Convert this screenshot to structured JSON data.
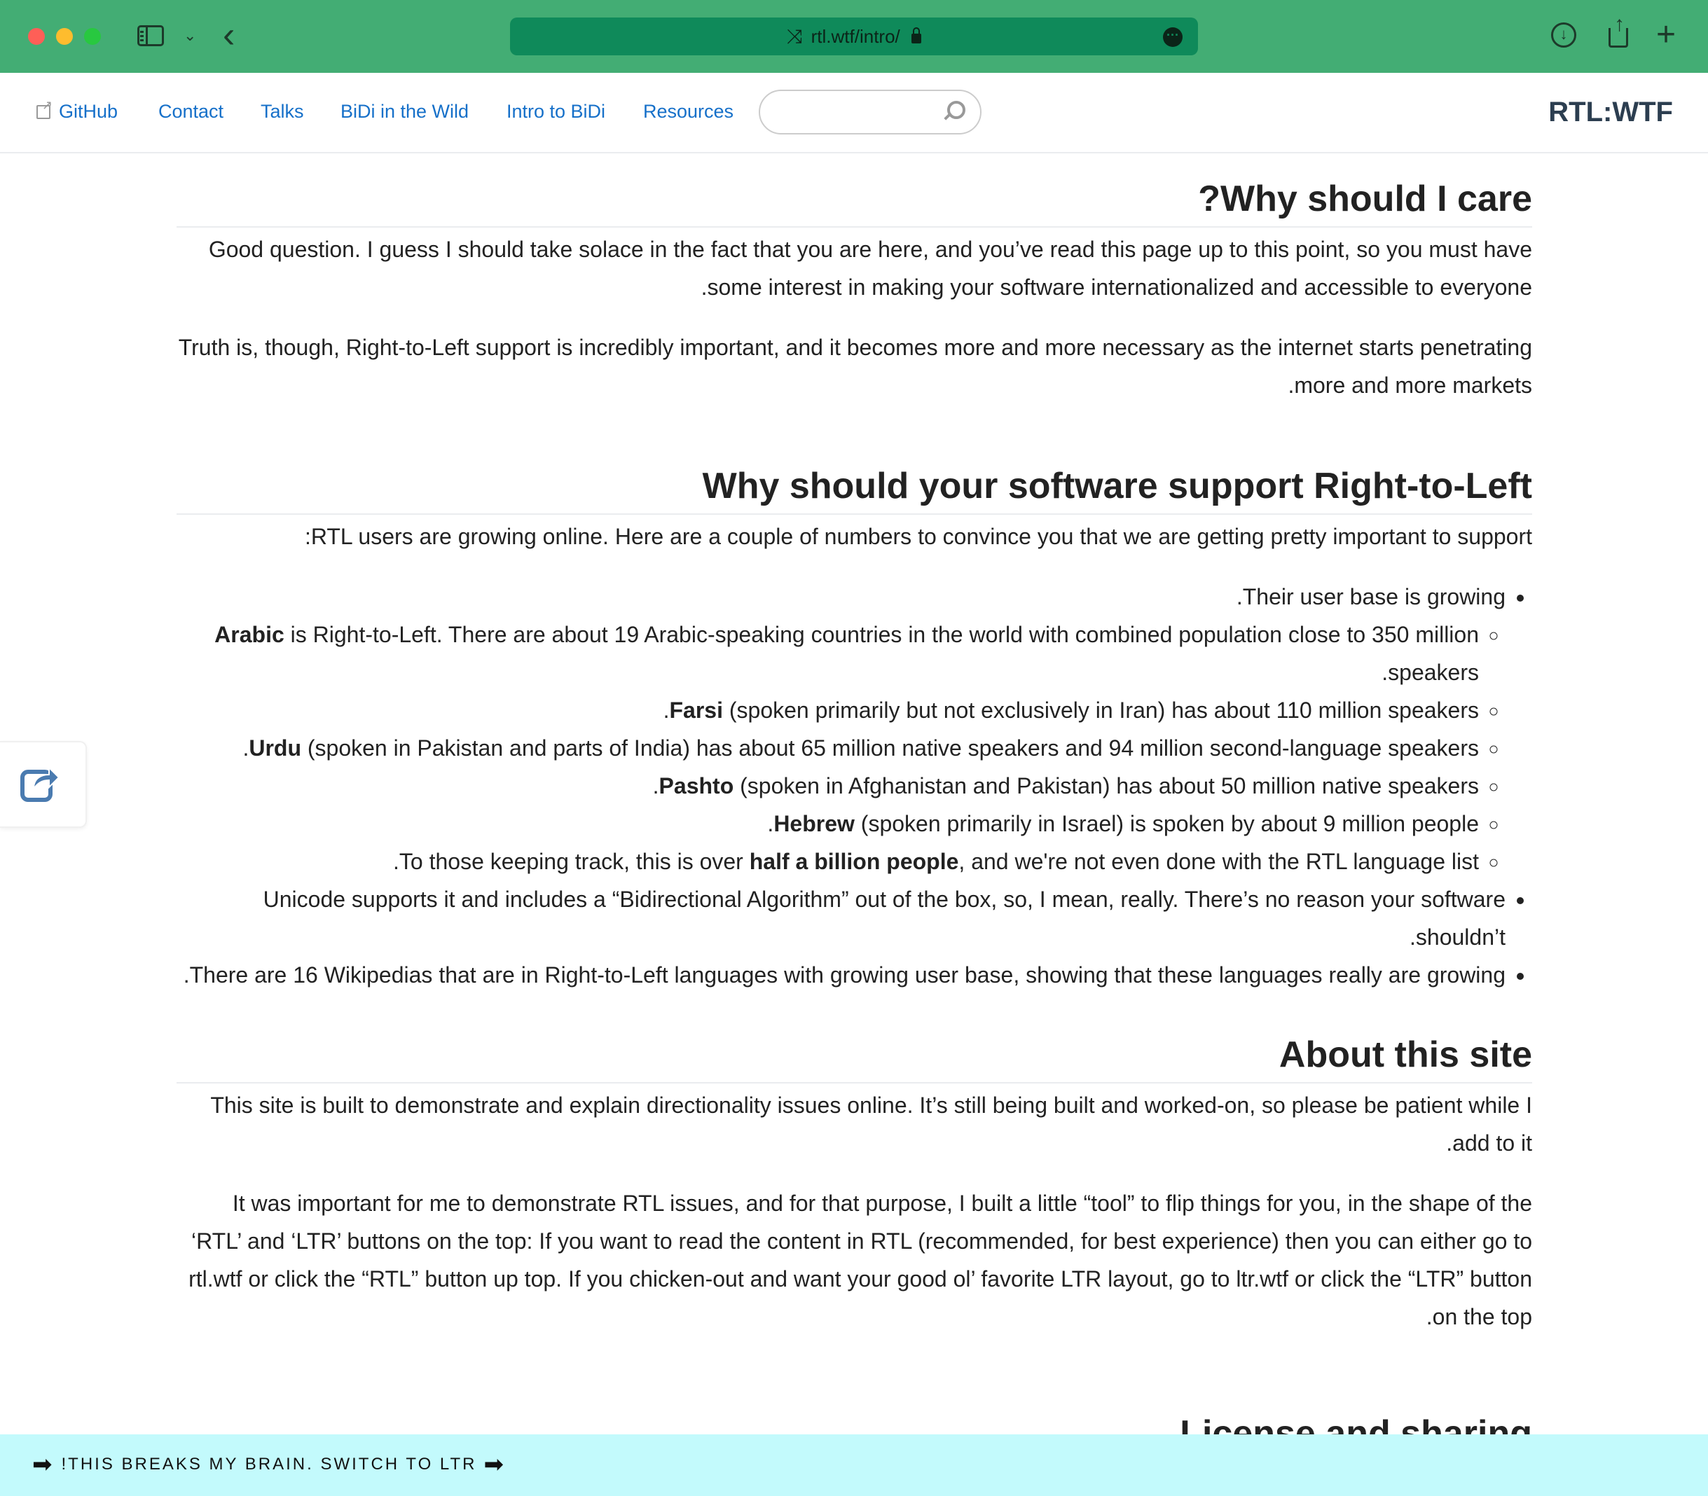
{
  "browser": {
    "url": "rtl.wtf/intro/"
  },
  "nav": {
    "links": [
      "GitHub",
      "Contact",
      "Talks",
      "BiDi in the Wild",
      "Intro to BiDi",
      "Resources"
    ],
    "search_placeholder": "",
    "site_title": "RTL:WTF"
  },
  "sections": {
    "care": {
      "heading": "Why should I care?",
      "p1": "Good question. I guess I should take solace in the fact that you are here, and you’ve read this page up to this point, so you must have some interest in making your software internationalized and accessible to everyone.",
      "p2": "Truth is, though, Right-to-Left support is incredibly important, and it becomes more and more necessary as the internet starts penetrating more and more markets."
    },
    "why": {
      "heading": "Why should your software support Right-to-Left",
      "intro": "RTL users are growing online. Here are a couple of numbers to convince you that we are getting pretty important to support:",
      "bullet1": "Their user base is growing.",
      "sub": [
        {
          "bold": "Arabic",
          "rest": " is Right-to-Left. There are about 19 Arabic-speaking countries in the world with combined population close to 350 million speakers."
        },
        {
          "bold": "Farsi",
          "rest": " (spoken primarily but not exclusively in Iran) has about 110 million speakers."
        },
        {
          "bold": "Urdu",
          "rest": " (spoken in Pakistan and parts of India) has about 65 million native speakers and 94 million second-language speakers."
        },
        {
          "bold": "Pashto",
          "rest": " (spoken in Afghanistan and Pakistan) has about 50 million native speakers."
        },
        {
          "bold": "Hebrew",
          "rest": " (spoken primarily in Israel) is spoken by about 9 million people."
        }
      ],
      "sub_last_pre": "To those keeping track, this is over ",
      "sub_last_bold": "half a billion people",
      "sub_last_post": ", and we're not even done with the RTL language list.",
      "bullet2": "Unicode supports it and includes a “Bidirectional Algorithm” out of the box, so, I mean, really. There’s no reason your software shouldn’t.",
      "bullet3": "There are 16 Wikipedias that are in Right-to-Left languages with growing user base, showing that these languages really are growing."
    },
    "about": {
      "heading": "About this site",
      "p1": "This site is built to demonstrate and explain directionality issues online. It’s still being built and worked-on, so please be patient while I add to it.",
      "p2": "It was important for me to demonstrate RTL issues, and for that purpose, I built a little “tool” to flip things for you, in the shape of the ‘RTL’ and ‘LTR’ buttons on the top: If you want to read the content in RTL (recommended, for best experience) then you can either go to rtl.wtf or click the “RTL” button up top. If you chicken-out and want your good ol’ favorite LTR layout, go to ltr.wtf or click the “LTR” button on the top."
    },
    "license": {
      "heading": "License and sharing"
    }
  },
  "bottom_bar": {
    "label": "THIS BREAKS MY BRAIN. SWITCH TO LTR!"
  },
  "colors": {
    "chrome": "#43ad74",
    "url_bar": "#0f8a5a",
    "link": "#1670c9",
    "bottom_bar": "#c3fafc"
  }
}
